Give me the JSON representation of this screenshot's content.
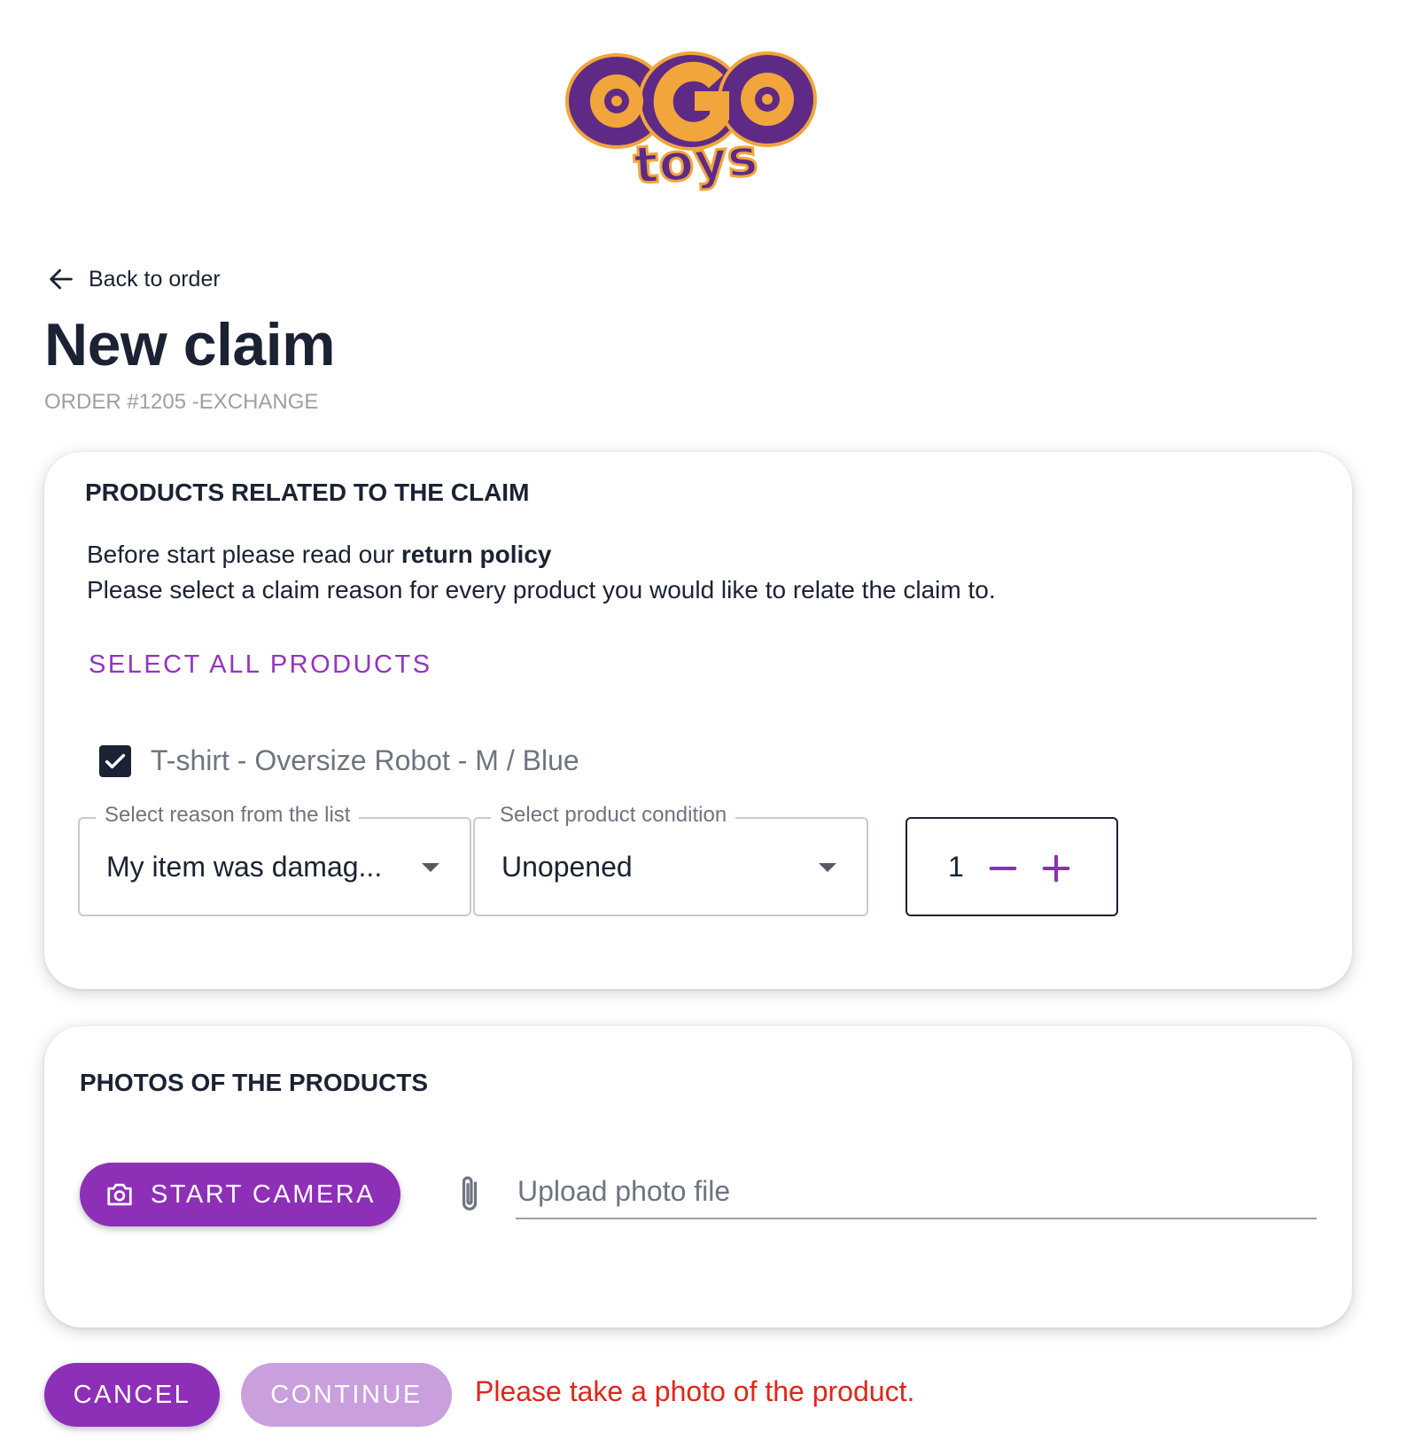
{
  "brand": {
    "logo_text_top": "OGO",
    "logo_text_bottom": "toys",
    "colors": {
      "primary": "#8e2fb8",
      "logo_purple": "#5e2a86",
      "logo_orange": "#f2a53a",
      "error": "#e0261b",
      "text": "#1a2233"
    }
  },
  "nav": {
    "back_label": "Back to order",
    "back_icon": "arrow-left-icon"
  },
  "header": {
    "title": "New claim",
    "subtitle": "ORDER #1205 -EXCHANGE"
  },
  "products_section": {
    "title": "PRODUCTS RELATED TO THE CLAIM",
    "intro_prefix": "Before start please read our ",
    "intro_link": "return policy",
    "intro_line2": "Please select a claim reason for every product you would like to relate the claim to.",
    "select_all_label": "SELECT ALL PRODUCTS",
    "items": [
      {
        "name": "T-shirt - Oversize Robot - M / Blue",
        "checked": true,
        "reason_label": "Select reason from the list",
        "reason_value": "My item was damag...",
        "condition_label": "Select product condition",
        "condition_value": "Unopened",
        "quantity": "1"
      }
    ]
  },
  "photos_section": {
    "title": "PHOTOS OF THE PRODUCTS",
    "camera_button_label": "START CAMERA",
    "camera_icon": "camera-icon",
    "upload_placeholder": "Upload photo file",
    "upload_icon": "paperclip-icon"
  },
  "footer": {
    "cancel_label": "CANCEL",
    "continue_label": "CONTINUE",
    "error_message": "Please take a photo of the product."
  }
}
